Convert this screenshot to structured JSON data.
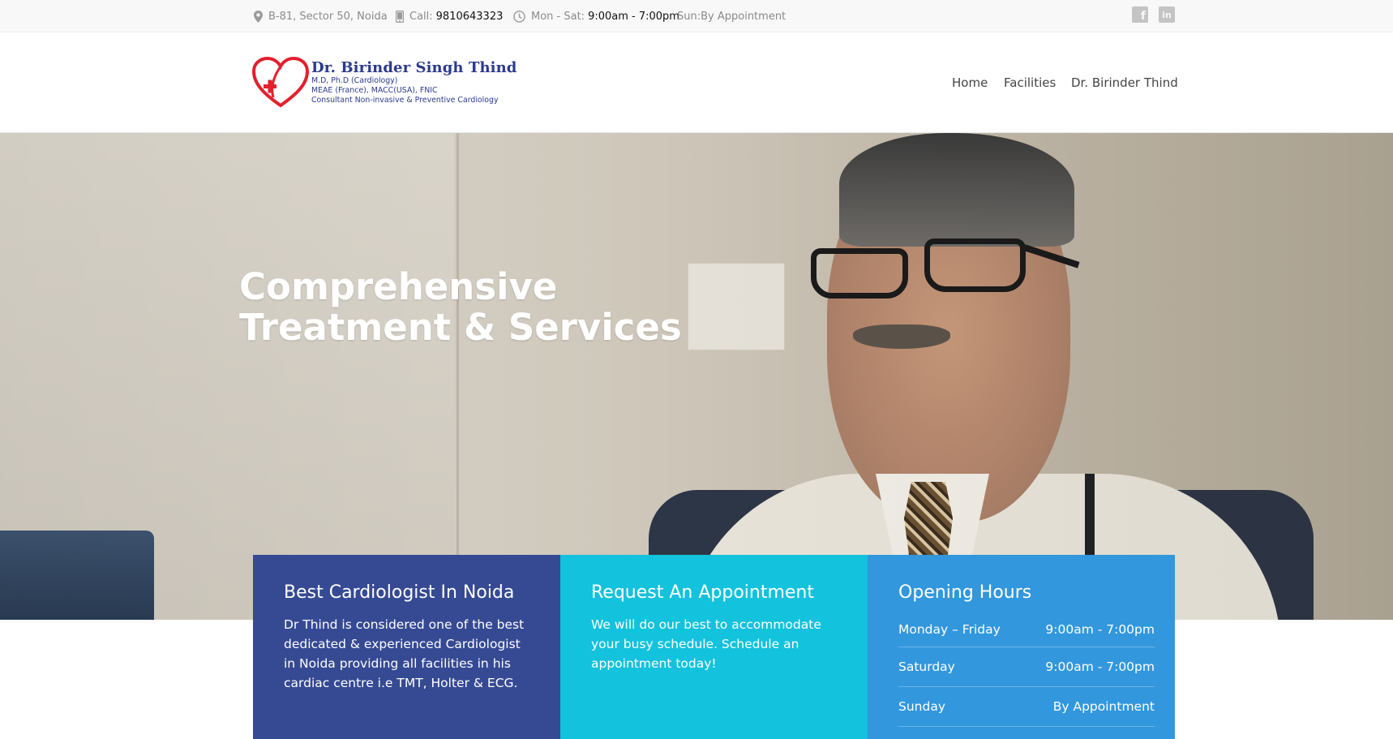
{
  "topbar": {
    "address": "B-81, Sector 50, Noida",
    "call_label": "Call:",
    "phone": "9810643323",
    "hours_label": "Mon - Sat:",
    "hours_value": "9:00am - 7:00pm",
    "sunday": "Sun:By Appointment",
    "social": [
      "facebook-icon",
      "linkedin-icon"
    ]
  },
  "logo": {
    "name": "Dr. Birinder Singh Thind",
    "line1": "M.D, Ph.D (Cardiology)",
    "line2": "MEAE (France), MACC(USA), FNIC",
    "line3": "Consultant Non-invasive & Preventive Cardiology"
  },
  "nav": {
    "items": [
      {
        "label": "Home"
      },
      {
        "label": "Facilities"
      },
      {
        "label": "Dr. Birinder Thind"
      }
    ]
  },
  "hero": {
    "title_line1": "Comprehensive",
    "title_line2": "Treatment & Services"
  },
  "boxes": {
    "about": {
      "title": "Best Cardiologist In Noida",
      "text": "Dr Thind is considered one of the best dedicated & experienced Cardiologist in Noida providing all facilities in his cardiac centre i.e TMT, Holter & ECG."
    },
    "appointment": {
      "title": "Request An Appointment",
      "text": "We will do our best to accommodate your busy schedule. Schedule an appointment today!"
    },
    "hours": {
      "title": "Opening Hours",
      "rows": [
        {
          "day": "Monday – Friday",
          "time": "9:00am - 7:00pm"
        },
        {
          "day": "Saturday",
          "time": "9:00am - 7:00pm"
        },
        {
          "day": "Sunday",
          "time": "By Appointment"
        }
      ]
    }
  },
  "colors": {
    "box_about": "#364a93",
    "box_appointment": "#13c2dc",
    "box_hours": "#3297dd",
    "logo_blue": "#2b3a8c",
    "logo_red": "#e3202e"
  }
}
